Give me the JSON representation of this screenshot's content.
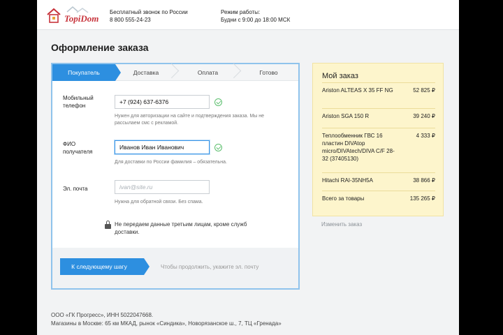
{
  "header": {
    "brand": "TopiDom",
    "phone_label": "Бесплатный звонок по России",
    "phone": "8 800 555-24-23",
    "hours_label": "Режим работы:",
    "hours": "Будни с 9:00 до 18:00 МСК"
  },
  "page_title": "Оформление заказа",
  "steps": [
    "Покупатель",
    "Доставка",
    "Оплата",
    "Готово"
  ],
  "form": {
    "phone": {
      "label": "Мобильный телефон",
      "value": "+7 (924) 637-6376",
      "hint": "Нужен для авторизации на сайте и подтверждения заказа. Мы не рассылаем смс с рекламой."
    },
    "name": {
      "label": "ФИО получателя",
      "value": "Иванов Иван Иванович",
      "hint": "Для доставки по России фамилия – обязательна."
    },
    "email": {
      "label": "Эл. почта",
      "value": "",
      "placeholder": "ivan@site.ru",
      "hint": "Нужна для обратной связи. Без спама."
    },
    "privacy": "Не передаем данные третьим лицам, кроме служб доставки.",
    "next_label": "К следующему шагу",
    "next_hint": "Чтобы продолжить, укажите эл. почту"
  },
  "order": {
    "title": "Мой заказ",
    "items": [
      {
        "name": "Ariston ALTEAS X 35 FF NG",
        "price": "52 825 ₽"
      },
      {
        "name": "Ariston SGA 150 R",
        "price": "39 240 ₽"
      },
      {
        "name": "Теплообменник ГВС 16 пластин DIVAtop micro/DIVAtech/DIVA C/F 28-32 (37405130)",
        "price": "4 333 ₽"
      },
      {
        "name": "Hitachi RAI-35NH5A",
        "price": "38 866 ₽"
      }
    ],
    "total_label": "Всего за товары",
    "total": "135 265 ₽",
    "change_link": "Изменить заказ"
  },
  "footer": {
    "line1": "ООО «ГК Прогресс», ИНН 5022047668.",
    "line2": "Магазины в Москве: 65 км МКАД, рынок «Синдика», Новорязанское ш., 7, ТЦ «Гренада»"
  },
  "colors": {
    "accent": "#2d8fe0",
    "order_bg": "#fdf5cc",
    "success": "#5cbf6e",
    "brand": "#c7333b"
  }
}
